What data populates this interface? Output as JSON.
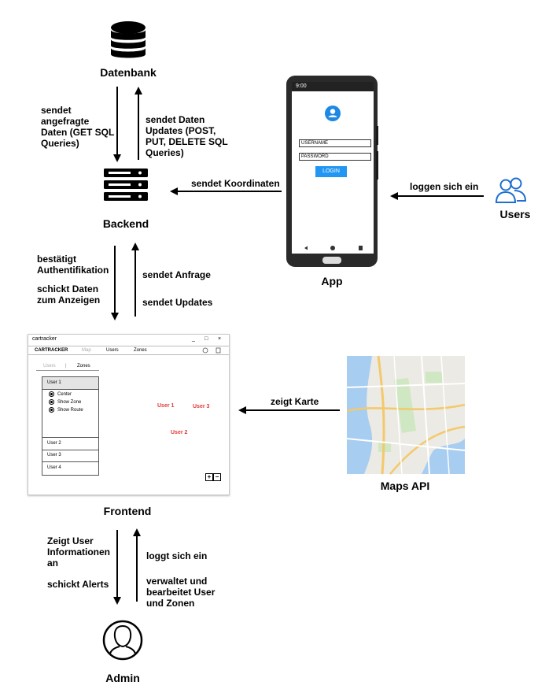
{
  "nodes": {
    "datenbank": "Datenbank",
    "backend": "Backend",
    "app": "App",
    "users": "Users",
    "frontend": "Frontend",
    "maps_api": "Maps API",
    "admin": "Admin"
  },
  "edges": {
    "db_to_backend": [
      "sendet",
      "angefragte",
      "Daten (GET SQL",
      "Queries)"
    ],
    "backend_to_db": [
      "sendet Daten",
      "Updates (POST,",
      "PUT, DELETE SQL",
      "Queries)"
    ],
    "app_to_backend": "sendet Koordinaten",
    "users_to_app": "loggen sich ein",
    "backend_to_frontend_1": [
      "bestätigt",
      "Authentifikation"
    ],
    "backend_to_frontend_2": [
      "schickt Daten",
      "zum Anzeigen"
    ],
    "frontend_to_backend_1": "sendet Anfrage",
    "frontend_to_backend_2": "sendet Updates",
    "maps_to_frontend": "zeigt Karte",
    "frontend_to_admin_1": [
      "Zeigt User",
      "Informationen",
      "an"
    ],
    "frontend_to_admin_2": "schickt Alerts",
    "admin_to_frontend_1": "loggt sich ein",
    "admin_to_frontend_2": [
      "verwaltet und",
      "bearbeitet User",
      "und Zonen"
    ]
  },
  "phone": {
    "time": "9:00",
    "username_placeholder": "USERNAME",
    "password_placeholder": "PASSWORD",
    "login_button": "LOGIN"
  },
  "frontend_window": {
    "title": "cartracker",
    "controls": [
      "_",
      "□",
      "×"
    ],
    "menu": [
      "CARTRACKER",
      "Map",
      "Users",
      "Zones"
    ],
    "tabs": [
      "Users",
      "|",
      "Zones"
    ],
    "users": [
      "User 1",
      "User 2",
      "User 3",
      "User 4"
    ],
    "user1_options": [
      "Center",
      "Show Zone",
      "Show Route"
    ],
    "map_markers": [
      "User 1",
      "User 3",
      "User 2"
    ],
    "zoom": [
      "+",
      "−"
    ]
  },
  "icons": [
    "database-icon",
    "server-icon",
    "users-icon",
    "admin-icon",
    "user-avatar-icon",
    "map-pin-icon"
  ],
  "colors": {
    "accent": "#2196f3",
    "icon_blue": "#1e6fd1",
    "marker": "#e53935"
  }
}
